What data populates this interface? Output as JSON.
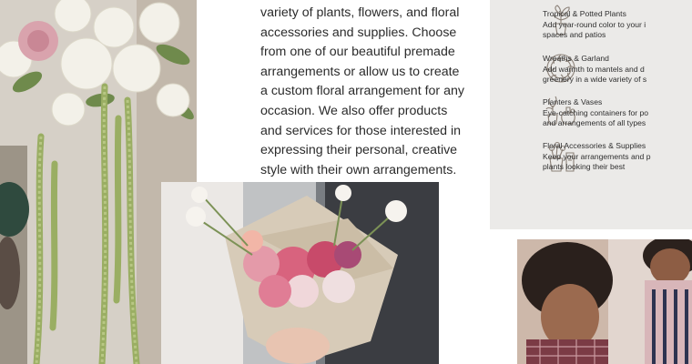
{
  "intro": {
    "lines": [
      "variety of plants, flowers, and floral",
      "accessories and supplies. Choose",
      "from one of our beautiful premade",
      "arrangements or allow us to create",
      "a custom floral arrangement for any",
      "occasion. We also offer products",
      "and services for those interested in",
      "expressing their personal, creative",
      "style with their own arrangements."
    ]
  },
  "categories": [
    {
      "icon": "potted-plant-icon",
      "title": "Tropical & Potted Plants",
      "desc_lines": [
        "Add year-round color to your i",
        "spaces and patios"
      ]
    },
    {
      "icon": "wreath-icon",
      "title": "Wreaths & Garland",
      "desc_lines": [
        "Add warmth to mantels and d",
        "greenery in a wide variety of s"
      ]
    },
    {
      "icon": "vases-icon",
      "title": "Planters & Vases",
      "desc_lines": [
        "Eye-catching containers for po",
        "and arrangements of all types"
      ]
    },
    {
      "icon": "accessories-icon",
      "title": "Floral Accessories & Supplies",
      "desc_lines": [
        "Keep your arrangements and p",
        "plants looking their best"
      ]
    }
  ],
  "colors": {
    "panel": "#ebeae8",
    "text": "#2b2b2b",
    "icon_stroke": "#8b8178"
  }
}
